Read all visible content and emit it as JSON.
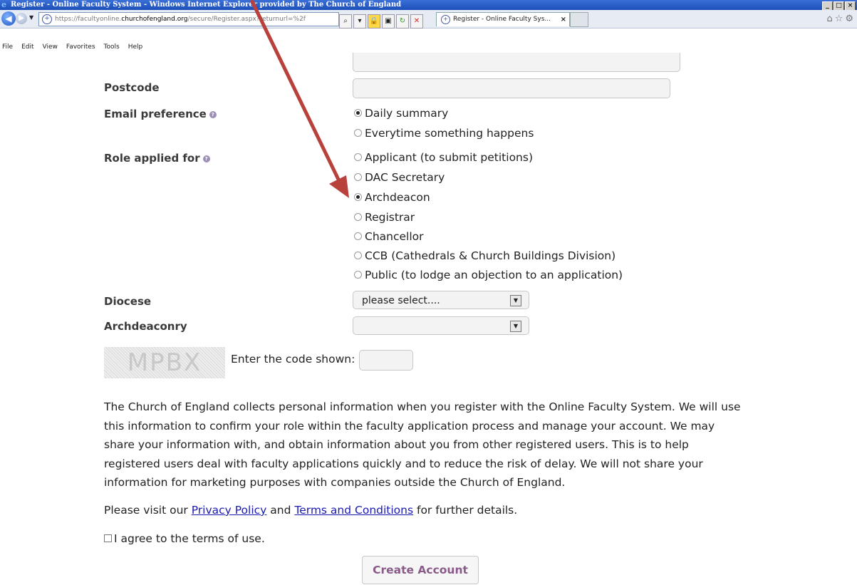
{
  "window": {
    "title": "Register - Online Faculty System - Windows Internet Explorer provided by The Church of England",
    "controls": [
      "_",
      "□",
      "×"
    ]
  },
  "browser": {
    "url_prefix": "https://facultyonline.",
    "url_domain": "churchofengland.org",
    "url_path": "/secure/Register.aspx?returnurl=%2f",
    "tab_title": "Register - Online Faculty Sys...",
    "tab_close": "×",
    "right_icons": "⌂☆⚙"
  },
  "menu": [
    "File",
    "Edit",
    "View",
    "Favorites",
    "Tools",
    "Help"
  ],
  "form": {
    "postcode_label": "Postcode",
    "email_pref_label": "Email preference",
    "email_options": [
      {
        "label": "Daily summary",
        "checked": true
      },
      {
        "label": "Everytime something happens",
        "checked": false
      }
    ],
    "role_label": "Role applied for",
    "role_options": [
      {
        "label": "Applicant (to submit petitions)",
        "checked": false
      },
      {
        "label": "DAC Secretary",
        "checked": false
      },
      {
        "label": "Archdeacon",
        "checked": true
      },
      {
        "label": "Registrar",
        "checked": false
      },
      {
        "label": "Chancellor",
        "checked": false
      },
      {
        "label": "CCB (Cathedrals & Church Buildings Division)",
        "checked": false
      },
      {
        "label": "Public (to lodge an objection to an application)",
        "checked": false
      }
    ],
    "diocese_label": "Diocese",
    "diocese_value": "please select....",
    "archdeaconry_label": "Archdeaconry",
    "archdeaconry_value": "",
    "captcha_text": "MPBX",
    "captcha_prompt": "Enter the code shown:",
    "privacy_paragraph": "The Church of England collects personal information when you register with the Online Faculty System. We will use this information to confirm your role within the faculty application process and manage your account. We may share your information with, and obtain information about you from other registered users. This is to help registered users deal with faculty applications quickly and to reduce the risk of delay. We will not share your information for marketing purposes with companies outside the Church of England.",
    "visit_prefix": "Please visit our ",
    "privacy_link": "Privacy Policy",
    "visit_and": " and ",
    "terms_link": "Terms and Conditions",
    "visit_suffix": " for further details.",
    "agree_label": "I agree to the terms of use.",
    "create_button": "Create Account"
  },
  "colors": {
    "annotation_arrow": "#b8413b",
    "link": "#1a1ab0",
    "button_text": "#8a5a8a"
  }
}
